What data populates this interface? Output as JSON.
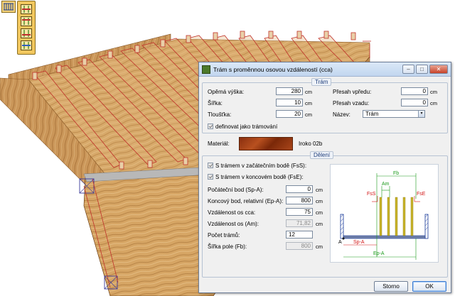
{
  "dialog": {
    "title": "Trám s proměnnou osovou vzdáleností (cca)",
    "window_buttons": {
      "minimize": "–",
      "maximize": "□",
      "close": "✕"
    }
  },
  "tram": {
    "caption": "Trám",
    "opena_vyska": {
      "label": "Opěmá výška:",
      "value": "280",
      "unit": "cm"
    },
    "sirka": {
      "label": "Šířka:",
      "value": "10",
      "unit": "cm"
    },
    "tloustka": {
      "label": "Tloušťka:",
      "value": "20",
      "unit": "cm"
    },
    "presah_vpredu": {
      "label": "Přesah vpředu:",
      "value": "0",
      "unit": "cm"
    },
    "presah_vzadu": {
      "label": "Přesah vzadu:",
      "value": "0",
      "unit": "cm"
    },
    "nazev": {
      "label": "Název:",
      "value": "Trám"
    },
    "definovat": {
      "label": "definovat jako trámování",
      "checked": true
    }
  },
  "material": {
    "label": "Materiál:",
    "name": "Iroko 02b"
  },
  "deleni": {
    "caption": "Dělení",
    "s_tramem_zacatek": {
      "label": "S trámem v začátečním bodě (FsS):",
      "checked": true
    },
    "s_tramem_konec": {
      "label": "S trámem v koncovém bodě (FsE):",
      "checked": true
    },
    "pocatecni_bod": {
      "label": "Počáteční bod  (Sp-A):",
      "value": "0",
      "unit": "cm"
    },
    "koncovy_bod": {
      "label": "Koncový bod, relativní  (Ep-A):",
      "value": "800",
      "unit": "cm"
    },
    "vzdalenost_cca": {
      "label": "Vzdálenost os cca:",
      "value": "75",
      "unit": "cm"
    },
    "vzdalenost_am": {
      "label": "Vzdálenost os (Am):",
      "value": "71,82",
      "unit": "cm"
    },
    "pocet_tramu": {
      "label": "Počet trámů:",
      "value": "12"
    },
    "sirka_pole": {
      "label": "Šířka pole (Fb):",
      "value": "800",
      "unit": "cm"
    }
  },
  "diagram_labels": {
    "fb": "Fb",
    "am": "Am",
    "fss": "FsS",
    "fse": "FsE",
    "a": "A",
    "spa": "Sp-A",
    "epa": "Ep-A"
  },
  "buttons": {
    "storno": "Storno",
    "ok": "OK"
  },
  "colors": {
    "dim_green": "#1a9a1a",
    "dim_red": "#d21414",
    "beam_yellow": "#c9b42a",
    "wood": "#c9995a"
  }
}
